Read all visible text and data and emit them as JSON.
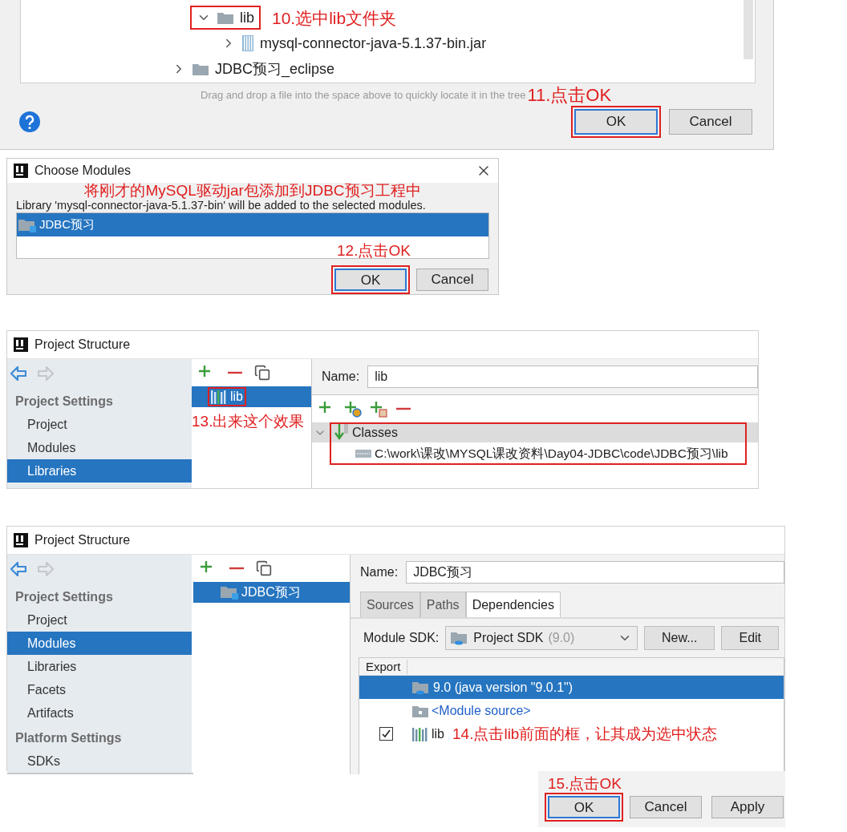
{
  "library_picker": {
    "tree": [
      {
        "children": [
          {
            "label": "lib",
            "kind": "folder",
            "expanded": true,
            "highlighted": true,
            "annotation": "10.选中lib文件夹",
            "children": [
              {
                "label": "mysql-connector-java-5.1.37-bin.jar",
                "kind": "jar",
                "expanded": false
              }
            ]
          }
        ]
      },
      {
        "label": "JDBC预习_eclipse",
        "kind": "folder",
        "expanded": false
      }
    ],
    "hint": "Drag and drop a file into the space above to quickly locate it in the tree",
    "hint_annotation": "11.点击OK",
    "buttons": [
      {
        "label": "OK",
        "default": true,
        "highlighted": true
      },
      {
        "label": "Cancel",
        "default": false,
        "highlighted": false
      }
    ]
  },
  "choose_modules": {
    "title": "Choose Modules",
    "annotation": "将刚才的MySQL驱动jar包添加到JDBC预习工程中",
    "description": "Library 'mysql-connector-java-5.1.37-bin' will be added to the selected modules.",
    "modules": [
      {
        "label": "JDBC预习",
        "selected": true
      }
    ],
    "list_annotation": "12.点击OK",
    "buttons": [
      {
        "label": "OK",
        "default": true,
        "highlighted": true
      },
      {
        "label": "Cancel",
        "default": false,
        "highlighted": false
      }
    ]
  },
  "project_structure_libraries": {
    "title": "Project Structure",
    "nav": [
      {
        "kind": "back",
        "disabled": false
      },
      {
        "kind": "forward",
        "disabled": true
      }
    ],
    "sidebar": [
      {
        "heading": "Project Settings",
        "items": [
          {
            "label": "Project",
            "selected": false
          },
          {
            "label": "Modules",
            "selected": false
          },
          {
            "label": "Libraries",
            "selected": true
          }
        ]
      }
    ],
    "list": [
      {
        "label": "lib",
        "kind": "library",
        "selected": true,
        "highlighted": true
      }
    ],
    "list_annotation": "13.出来这个效果",
    "name_label": "Name:",
    "name_value": "lib",
    "classes": {
      "label": "Classes",
      "expanded": true,
      "highlighted": true,
      "paths": [
        "C:\\work\\课改\\MYSQL课改资料\\Day04-JDBC\\code\\JDBC预习\\lib"
      ]
    }
  },
  "project_structure_modules": {
    "title": "Project Structure",
    "nav": [
      {
        "kind": "back",
        "disabled": false
      },
      {
        "kind": "forward",
        "disabled": true
      }
    ],
    "sidebar": [
      {
        "heading": "Project Settings",
        "items": [
          {
            "label": "Project",
            "selected": false
          },
          {
            "label": "Modules",
            "selected": true
          },
          {
            "label": "Libraries",
            "selected": false
          },
          {
            "label": "Facets",
            "selected": false
          },
          {
            "label": "Artifacts",
            "selected": false
          }
        ]
      },
      {
        "heading": "Platform Settings",
        "items": [
          {
            "label": "SDKs",
            "selected": false
          }
        ]
      }
    ],
    "list": [
      {
        "label": "JDBC预习",
        "kind": "module",
        "selected": true,
        "highlighted": false
      }
    ],
    "name_label": "Name:",
    "name_value": "JDBC预习",
    "tabs": [
      {
        "label": "Sources",
        "selected": false
      },
      {
        "label": "Paths",
        "selected": false
      },
      {
        "label": "Dependencies",
        "selected": true
      }
    ],
    "sdk": {
      "label": "Module SDK:",
      "value": "Project SDK",
      "version": "(9.0)",
      "buttons": [
        "New...",
        "Edit"
      ]
    },
    "table": {
      "header": "Export",
      "rows": [
        {
          "kind": "sdk",
          "label": "9.0 (java version \"9.0.1\")",
          "selected": true
        },
        {
          "kind": "source",
          "label": "<Module source>",
          "selected": false
        },
        {
          "kind": "library",
          "label": "lib",
          "selected": false,
          "checked": true,
          "annotation": "14.点击lib前面的框，让其成为选中状态"
        }
      ]
    },
    "footer": {
      "annotation": "15.点击OK",
      "buttons": [
        {
          "label": "OK",
          "default": true,
          "highlighted": true
        },
        {
          "label": "Cancel",
          "default": false,
          "highlighted": false
        },
        {
          "label": "Apply",
          "default": false,
          "highlighted": false
        }
      ]
    }
  }
}
